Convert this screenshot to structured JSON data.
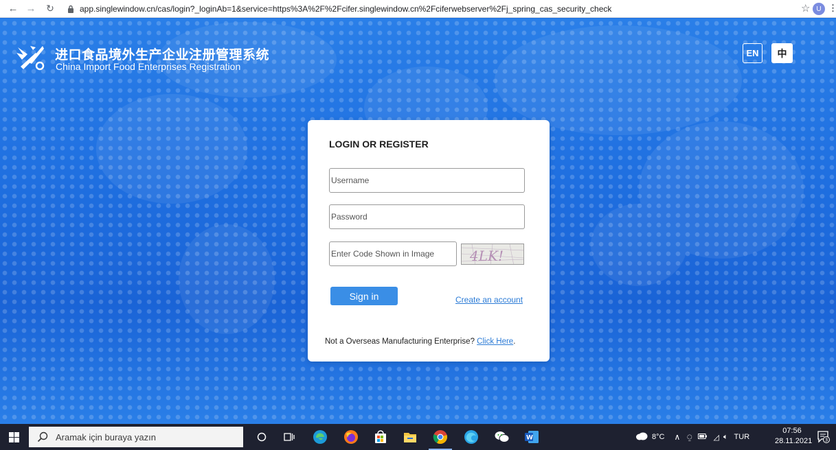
{
  "browser": {
    "url": "app.singlewindow.cn/cas/login?_loginAb=1&service=https%3A%2F%2Fcifer.singlewindow.cn%2Fciferwebserver%2Fj_spring_cas_security_check",
    "profile_initial": "U"
  },
  "header": {
    "title_cn": "进口食品境外生产企业注册管理系统",
    "title_en": "China Import Food Enterprises Registration",
    "lang_en": "EN",
    "lang_cn": "中"
  },
  "login": {
    "heading": "LOGIN OR REGISTER",
    "username_placeholder": "Username",
    "password_placeholder": "Password",
    "captcha_placeholder": "Enter Code Shown in Image",
    "captcha_text": "4LK!",
    "signin_label": "Sign in",
    "create_account_label": "Create an account",
    "not_overseas_text": "Not a Overseas Manufacturing Enterprise?",
    "click_here_label": "Click Here",
    "click_here_suffix": "."
  },
  "taskbar": {
    "search_placeholder": "Aramak için buraya yazın",
    "weather": "8°C",
    "language": "TUR",
    "time": "07:56",
    "date": "28.11.2021",
    "notification_count": "3"
  },
  "colors": {
    "page_blue": "#1f6fe0",
    "button_blue": "#3a8ee6",
    "link_blue": "#2b7bd6",
    "taskbar": "#1e2130"
  }
}
